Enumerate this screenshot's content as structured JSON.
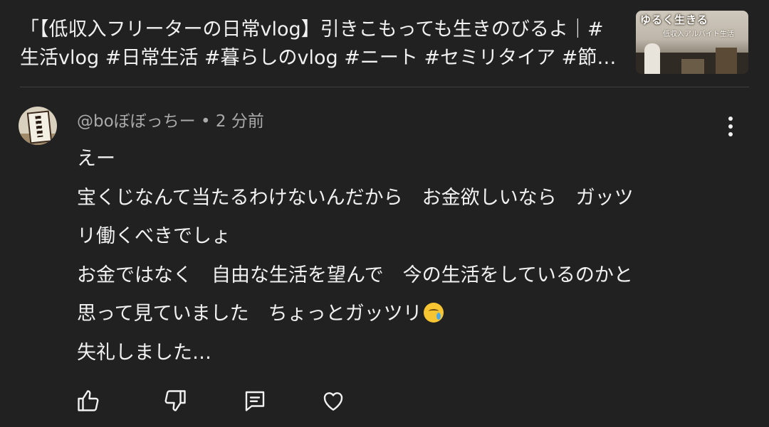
{
  "video": {
    "title": "「【低収入フリーターの日常vlog】引きこもっても生きのびるよ｜#生活vlog #日常生活 #暮らしのvlog #ニート #セミリタイア #節約生活 #一人暮らし",
    "thumbnail_text_main": "ゆるく生きる",
    "thumbnail_text_sub": "低収入アルバイト生活"
  },
  "comment": {
    "author": "@boぼぼっちー",
    "separator": " • ",
    "time": "2 分前",
    "lines": [
      "えー",
      "宝くじなんて当たるわけないんだから　お金欲しいなら　ガッツ",
      "リ働くべきでしょ",
      "お金ではなく　自由な生活を望んで　今の生活をしているのかと",
      "思って見ていました　ちょっとガッツリ",
      "失礼しました…"
    ],
    "emoji": "crying-face"
  },
  "icons": {
    "menu": "more-vert-icon",
    "like": "thumb-up-icon",
    "dislike": "thumb-down-icon",
    "reply": "comment-icon",
    "heart": "heart-icon"
  },
  "colors": {
    "background": "#212121",
    "primary_text": "#f1f1f1",
    "secondary_text": "#aaaaaa",
    "divider": "#3f3f3f"
  }
}
